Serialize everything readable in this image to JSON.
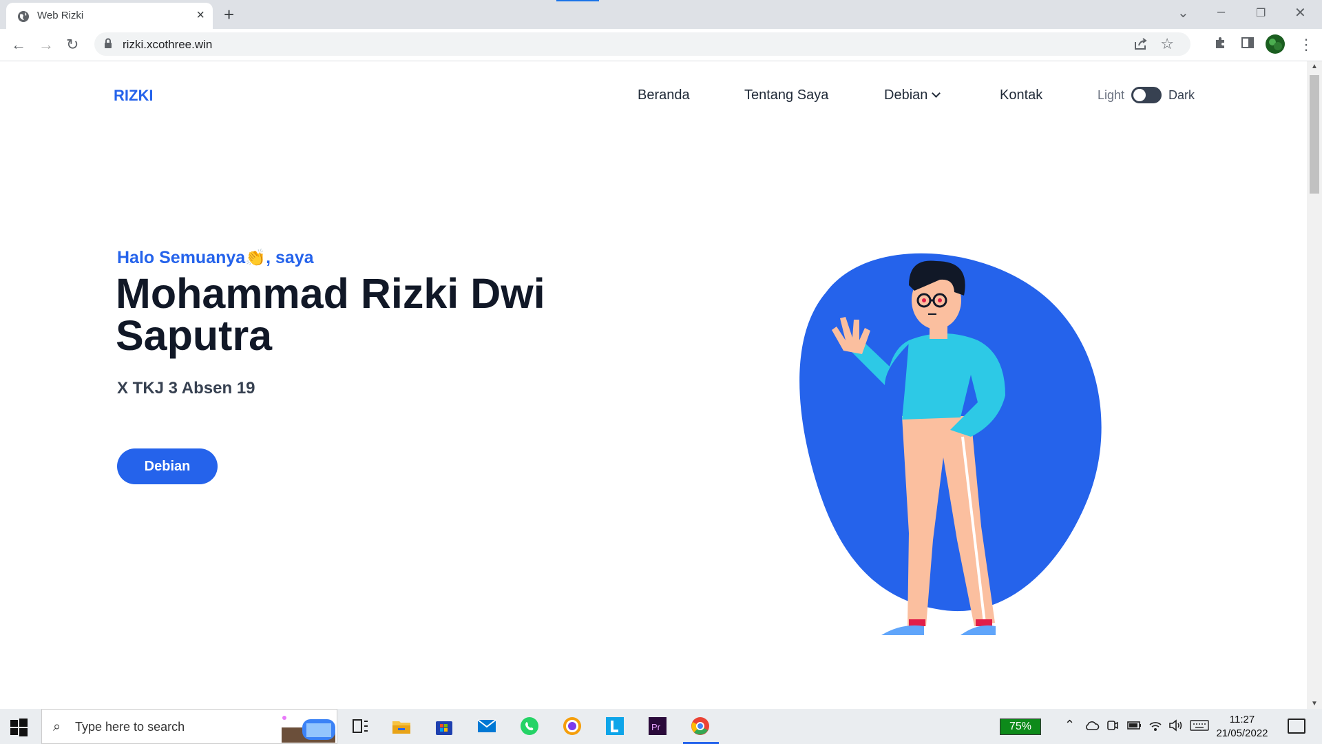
{
  "browser": {
    "tab_title": "Web Rizki",
    "url": "rizki.xcothree.win"
  },
  "site": {
    "logo": "RIZKI",
    "nav": [
      "Beranda",
      "Tentang Saya",
      "Debian",
      "Kontak"
    ],
    "theme_toggle": {
      "light": "Light",
      "dark": "Dark"
    },
    "hero": {
      "greeting": "Halo Semuanya",
      "greeting_emoji": "👏",
      "greeting_suffix": ", saya",
      "name": "Mohammad Rizki Dwi Saputra",
      "subtitle": "X TKJ 3 Absen 19",
      "button": "Debian"
    },
    "colors": {
      "accent": "#2563eb",
      "shirt": "#2dc9e6",
      "pants": "#fbbf9f"
    }
  },
  "taskbar": {
    "search_placeholder": "Type here to search",
    "battery": "75%",
    "time": "11:27",
    "date": "21/05/2022"
  }
}
